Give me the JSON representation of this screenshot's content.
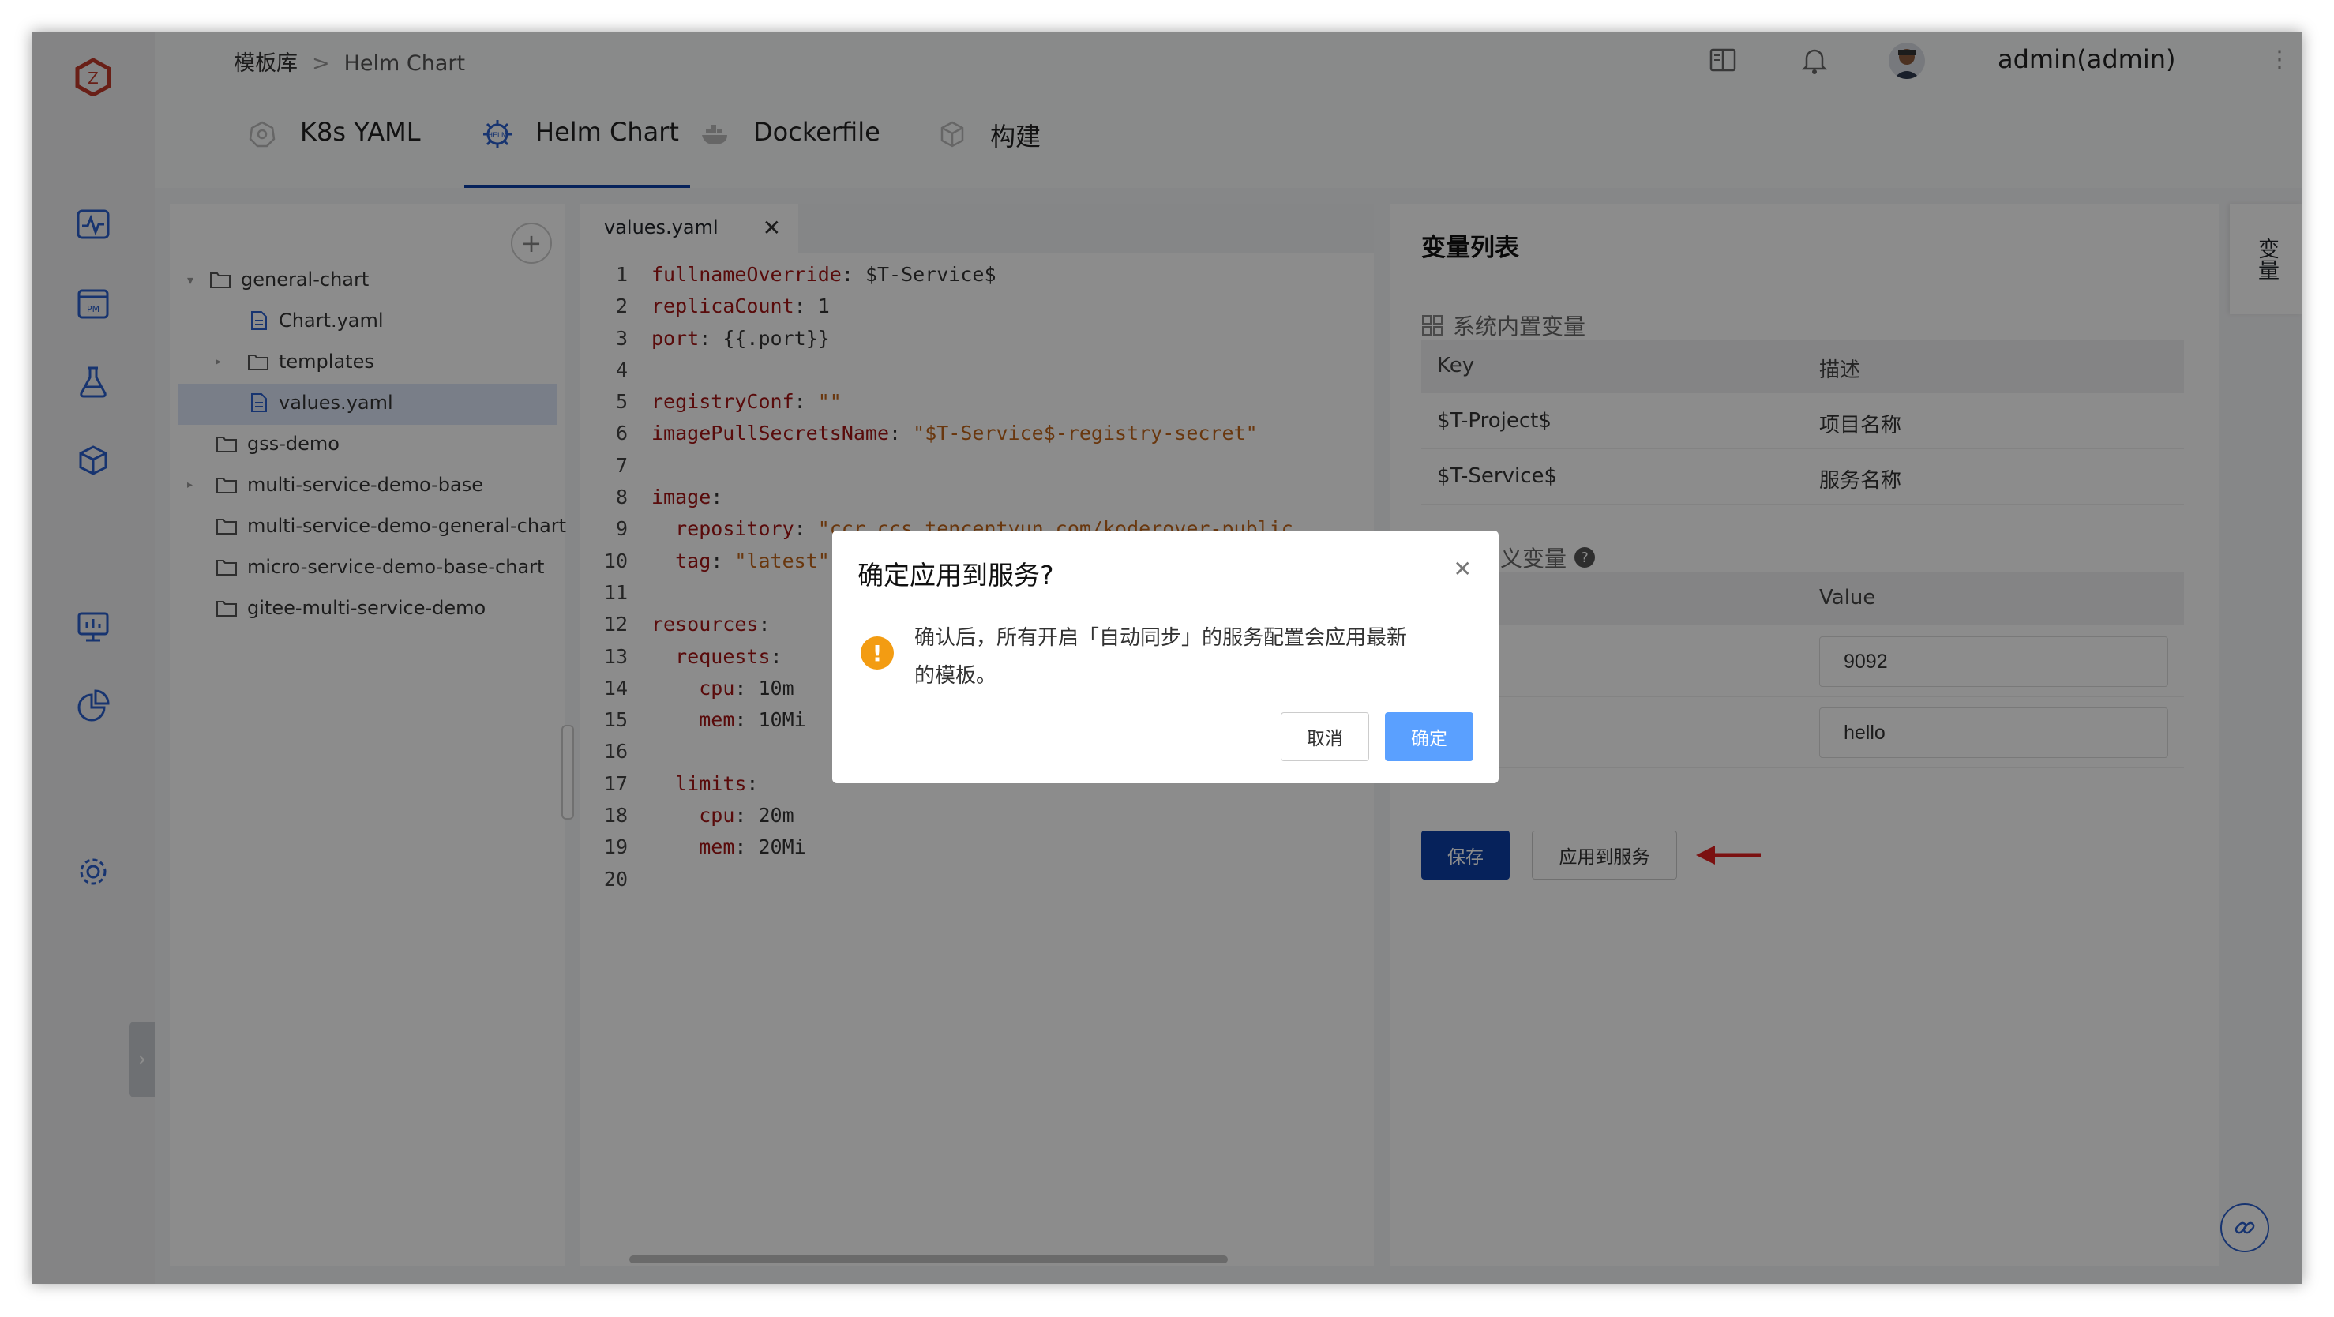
{
  "breadcrumb": {
    "home": "模板库",
    "separator": ">",
    "current": "Helm Chart"
  },
  "header": {
    "user": "admin(admin)",
    "icons": [
      "book-icon",
      "bell-icon",
      "avatar",
      "more-icon"
    ]
  },
  "tabs": [
    {
      "label": "K8s YAML",
      "icon": "k8s-icon"
    },
    {
      "label": "Helm Chart",
      "icon": "helm-icon",
      "active": true
    },
    {
      "label": "Dockerfile",
      "icon": "docker-icon"
    },
    {
      "label": "构建",
      "icon": "build-icon"
    }
  ],
  "tree": {
    "items": [
      {
        "label": "general-chart",
        "type": "folder",
        "expanded": true
      },
      {
        "label": "Chart.yaml",
        "type": "file"
      },
      {
        "label": "templates",
        "type": "folder"
      },
      {
        "label": "values.yaml",
        "type": "file",
        "selected": true
      },
      {
        "label": "gss-demo",
        "type": "folder"
      },
      {
        "label": "multi-service-demo-base",
        "type": "folder"
      },
      {
        "label": "multi-service-demo-general-chart",
        "type": "folder"
      },
      {
        "label": "micro-service-demo-base-chart",
        "type": "folder"
      },
      {
        "label": "gitee-multi-service-demo",
        "type": "folder"
      }
    ]
  },
  "editor": {
    "tab": "values.yaml",
    "lines": [
      "fullnameOverride: $T-Service$",
      "replicaCount: 1",
      "port: {{.port}}",
      "",
      "registryConf: \"\"",
      "imagePullSecretsName: \"$T-Service$-registry-secret\"",
      "",
      "image:",
      "  repository: \"ccr.ccs.tencentyun.com/koderover-public",
      "  tag: \"latest\"",
      "",
      "resources:",
      "  requests:",
      "    cpu: 10m",
      "    mem: 10Mi",
      "",
      "  limits:",
      "    cpu: 20m",
      "    mem: 20Mi",
      ""
    ]
  },
  "variables": {
    "title": "变量列表",
    "system_title": "系统内置变量",
    "system_headers": [
      "Key",
      "描述"
    ],
    "system_rows": [
      [
        "$T-Project$",
        "项目名称"
      ],
      [
        "$T-Service$",
        "服务名称"
      ]
    ],
    "custom_title": "义变量",
    "custom_header_value": "Value",
    "custom_values": [
      "9092",
      "hello"
    ],
    "save_label": "保存",
    "apply_label": "应用到服务"
  },
  "side_tab": "变量",
  "dialog": {
    "title": "确定应用到服务?",
    "message_line1": "确认后，所有开启「自动同步」的服务配置会应用最新",
    "message_line2": "的模板。",
    "cancel_label": "取消",
    "confirm_label": "确定"
  },
  "colors": {
    "primary": "#0b3ea6",
    "confirm": "#5aa0ff",
    "warning": "#f39c12",
    "arrow": "#e02020"
  }
}
